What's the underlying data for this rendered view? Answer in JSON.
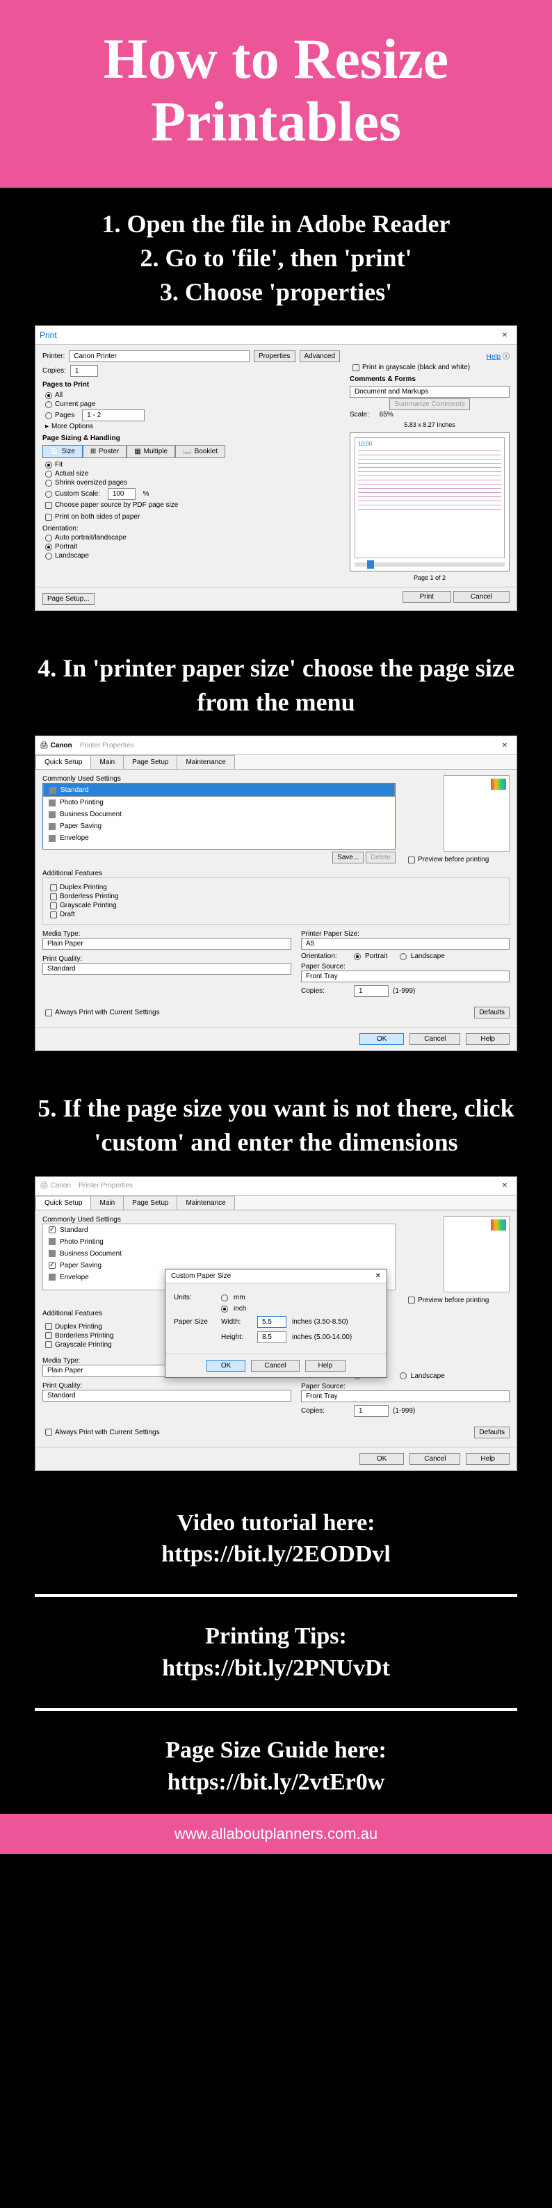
{
  "hero": {
    "line1": "How to Resize",
    "line2": "Printables"
  },
  "steps": {
    "s1": "1. Open the file in Adobe Reader",
    "s2": "2. Go to 'file', then 'print'",
    "s3": "3. Choose 'properties'",
    "s4": "4. In 'printer paper size' choose the page size from the menu",
    "s5": "5. If the page size you want is not there, click 'custom' and enter the dimensions"
  },
  "printDialog": {
    "title": "Print",
    "printerLabel": "Printer:",
    "printerValue": "Canon           Printer",
    "propertiesBtn": "Properties",
    "advancedBtn": "Advanced",
    "helpLink": "Help",
    "copiesLabel": "Copies:",
    "copiesValue": "1",
    "grayscaleLabel": "Print in grayscale (black and white)",
    "pagesToPrint": "Pages to Print",
    "optAll": "All",
    "optCurrent": "Current page",
    "optPages": "Pages",
    "pagesValue": "1 - 2",
    "moreOptions": "More Options",
    "sizingTitle": "Page Sizing & Handling",
    "tabSize": "Size",
    "tabPoster": "Poster",
    "tabMultiple": "Multiple",
    "tabBooklet": "Booklet",
    "fit": "Fit",
    "actual": "Actual size",
    "shrink": "Shrink oversized pages",
    "customScale": "Custom Scale:",
    "customScaleVal": "100",
    "pct": "%",
    "pdfSize": "Choose paper source by PDF page size",
    "bothSides": "Print on both sides of paper",
    "orientation": "Orientation:",
    "autoOrient": "Auto portrait/landscape",
    "portrait": "Portrait",
    "landscape": "Landscape",
    "commentsForms": "Comments & Forms",
    "commentsValue": "Document and Markups",
    "summarize": "Summarize Comments",
    "scaleLabel": "Scale:",
    "scaleValue": "65%",
    "paperDims": "5.83 x 8.27 Inches",
    "previewTime": "10:00",
    "pageOf": "Page 1 of 2",
    "pageSetup": "Page Setup...",
    "printBtn": "Print",
    "cancelBtn": "Cancel"
  },
  "canonDialog": {
    "brand": "Canon",
    "title": "Printer Properties",
    "tabs": [
      "Quick Setup",
      "Main",
      "Page Setup",
      "Maintenance"
    ],
    "commonUsed": "Commonly Used Settings",
    "items": [
      "Standard",
      "Photo Printing",
      "Business Document",
      "Paper Saving",
      "Envelope"
    ],
    "saveBtn": "Save...",
    "deleteBtn": "Delete",
    "previewBefore": "Preview before printing",
    "additional": "Additional Features",
    "feat": [
      "Duplex Printing",
      "Borderless Printing",
      "Grayscale Printing",
      "Draft"
    ],
    "mediaType": "Media Type:",
    "mediaValue": "Plain Paper",
    "paperSize": "Printer Paper Size:",
    "paperValue": "A5",
    "orientation": "Orientation:",
    "portrait": "Portrait",
    "landscape": "Landscape",
    "quality": "Print Quality:",
    "qualityValue": "Standard",
    "source": "Paper Source:",
    "sourceValue": "Front Tray",
    "copies": "Copies:",
    "copiesValue": "1",
    "copiesRange": "(1-999)",
    "always": "Always Print with Current Settings",
    "defaults": "Defaults",
    "ok": "OK",
    "cancel": "Cancel",
    "help": "Help"
  },
  "customModal": {
    "title": "Custom Paper Size",
    "units": "Units:",
    "mm": "mm",
    "inch": "inch",
    "paperSize": "Paper Size",
    "width": "Width:",
    "widthVal": "5.5",
    "widthRange": "inches (3.50-8.50)",
    "height": "Height:",
    "heightVal": "8.5",
    "heightRange": "inches (5.00-14.00)",
    "ok": "OK",
    "cancel": "Cancel",
    "help": "Help"
  },
  "info": {
    "video1": "Video tutorial here:",
    "video2": "https://bit.ly/2EODDvl",
    "tips1": "Printing Tips:",
    "tips2": "https://bit.ly/2PNUvDt",
    "guide1": "Page Size Guide here:",
    "guide2": "https://bit.ly/2vtEr0w"
  },
  "footerUrl": "www.allaboutplanners.com.au"
}
